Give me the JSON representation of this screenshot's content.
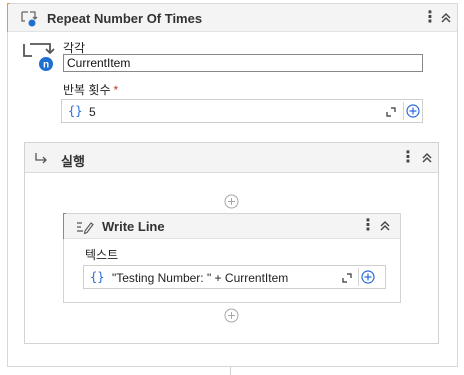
{
  "activity": {
    "title": "Repeat Number Of Times",
    "icon": "repeat-activity-icon"
  },
  "item_field": {
    "label": "각각",
    "value": "CurrentItem"
  },
  "count_field": {
    "label": "반복 횟수",
    "required_mark": "*",
    "braces": "{}",
    "value": "5"
  },
  "body": {
    "title": "실행"
  },
  "write_line": {
    "title": "Write Line",
    "text_label": "텍스트",
    "braces": "{}",
    "value": "\"Testing Number: \" + CurrentItem"
  },
  "kebab": "⋮",
  "colors": {
    "accent": "#f0a000",
    "brace": "#2a6ad8",
    "loop_badge": "#1f6fd1"
  }
}
